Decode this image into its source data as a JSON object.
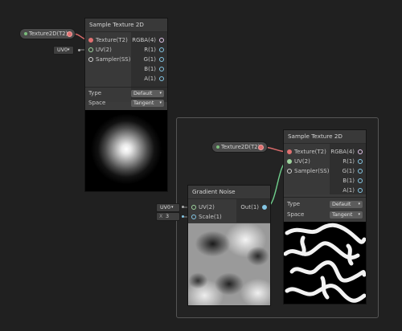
{
  "colors": {
    "canvas": "#202020",
    "node": "#3b3b3b",
    "texture_port": "#e07070",
    "vector2_port": "#9ed49e",
    "float_port": "#84c6e4",
    "vector4_port": "#e4c6ec",
    "sampler_port": "#d0d0d0",
    "uv_wire": "#6fcf8c",
    "texture_wire": "#d96a6a"
  },
  "texture_property_top": {
    "label": "Texture2D(T2)"
  },
  "uv_inline_top": {
    "value": "UV0",
    "arrow": "▾"
  },
  "sample_texture_top": {
    "title": "Sample Texture 2D",
    "inputs": [
      "Texture(T2)",
      "UV(2)",
      "Sampler(SS)"
    ],
    "outputs": [
      "RGBA(4)",
      "R(1)",
      "G(1)",
      "B(1)",
      "A(1)"
    ],
    "type_label": "Type",
    "type_value": "Default",
    "space_label": "Space",
    "space_value": "Tangent",
    "preview_icon": "radial-gradient-preview"
  },
  "group": {
    "label": ""
  },
  "texture_property_group": {
    "label": "Texture2D(T2)"
  },
  "gradient_noise": {
    "title": "Gradient Noise",
    "inputs": [
      "UV(2)",
      "Scale(1)"
    ],
    "outputs": [
      "Out(1)"
    ],
    "preview_icon": "gradient-noise-preview"
  },
  "uv_inline_noise": {
    "value": "UV0",
    "arrow": "▾"
  },
  "scale_inline": {
    "axis": "X",
    "value": "3"
  },
  "sample_texture_group": {
    "title": "Sample Texture 2D",
    "inputs": [
      "Texture(T2)",
      "UV(2)",
      "Sampler(SS)"
    ],
    "outputs": [
      "RGBA(4)",
      "R(1)",
      "G(1)",
      "B(1)",
      "A(1)"
    ],
    "type_label": "Type",
    "type_value": "Default",
    "space_label": "Space",
    "space_value": "Tangent",
    "preview_icon": "noise-pattern-preview"
  }
}
